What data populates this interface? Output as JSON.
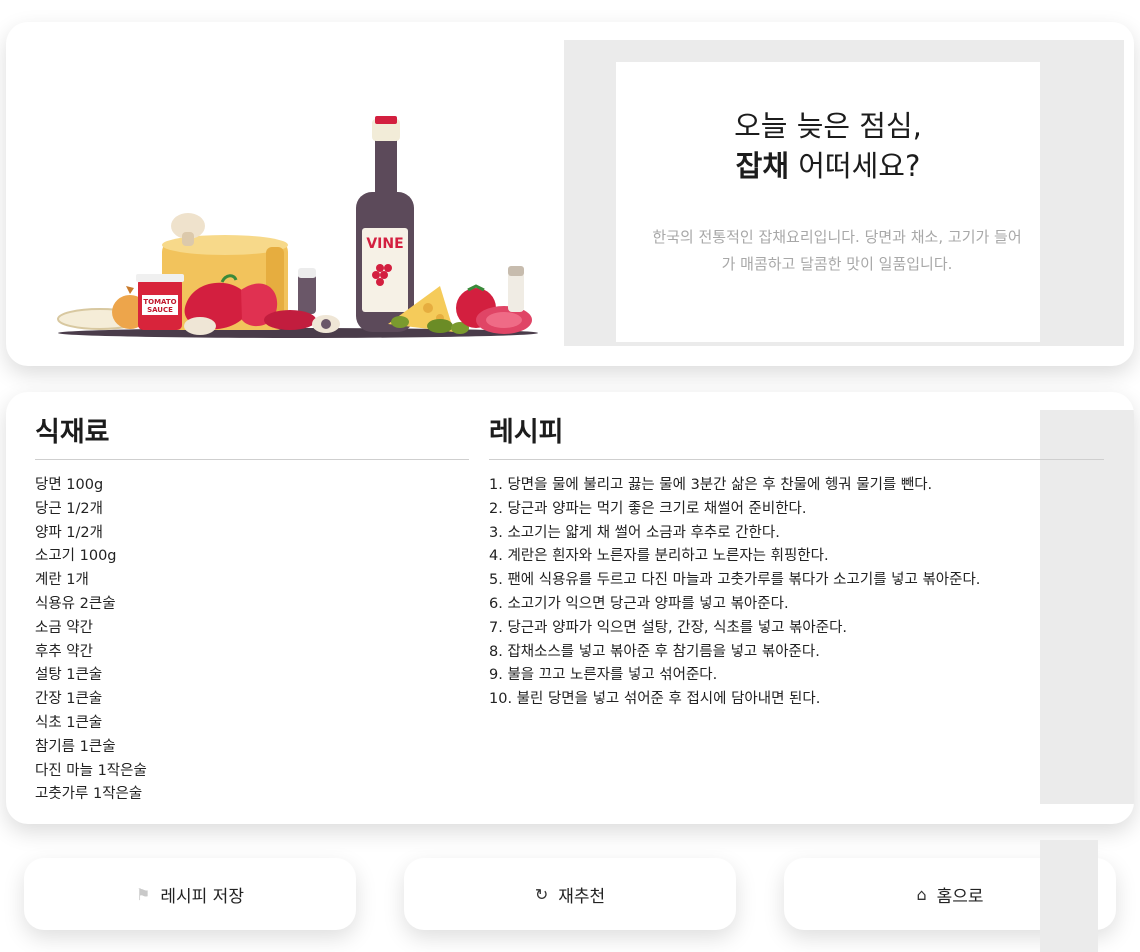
{
  "hero": {
    "headline_line1": "오늘 늦은 점심,",
    "headline_strong": "잡채",
    "headline_rest": " 어떠세요?",
    "description": "한국의 전통적인 잡채요리입니다. 당면과 채소, 고기가 들어가 매콤하고 달콤한 맛이 일품입니다.",
    "illustration": {
      "bottle_label": "VINE",
      "jar_label_line1": "TOMATO",
      "jar_label_line2": "SAUCE"
    }
  },
  "ingredients": {
    "title": "식재료",
    "items": [
      "당면 100g",
      "당근 1/2개",
      "양파 1/2개",
      "소고기 100g",
      "계란 1개",
      "식용유 2큰술",
      "소금 약간",
      "후추 약간",
      "설탕 1큰술",
      "간장 1큰술",
      "식초 1큰술",
      "참기름 1큰술",
      "다진 마늘 1작은술",
      "고춧가루 1작은술"
    ]
  },
  "recipe": {
    "title": "레시피",
    "steps": [
      "1. 당면을 물에 불리고 끓는 물에 3분간 삶은 후 찬물에 헹궈 물기를 뺀다.",
      "2. 당근과 양파는 먹기 좋은 크기로 채썰어 준비한다.",
      "3. 소고기는 얇게 채 썰어 소금과 후추로 간한다.",
      "4. 계란은 흰자와 노른자를 분리하고 노른자는 휘핑한다.",
      "5. 팬에 식용유를 두르고 다진 마늘과 고춧가루를 볶다가 소고기를 넣고 볶아준다.",
      "6. 소고기가 익으면 당근과 양파를 넣고 볶아준다.",
      "7. 당근과 양파가 익으면 설탕, 간장, 식초를 넣고 볶아준다.",
      "8. 잡채소스를 넣고 볶아준 후 참기름을 넣고 볶아준다.",
      "9. 불을 끄고 노른자를 넣고 섞어준다.",
      "10. 불린 당면을 넣고 섞어준 후 접시에 담아내면 된다."
    ]
  },
  "actions": {
    "save": {
      "label": "레시피 저장",
      "icon": "bookmark-icon"
    },
    "retry": {
      "label": "재추천",
      "icon": "refresh-icon"
    },
    "home": {
      "label": "홈으로",
      "icon": "home-icon"
    }
  }
}
